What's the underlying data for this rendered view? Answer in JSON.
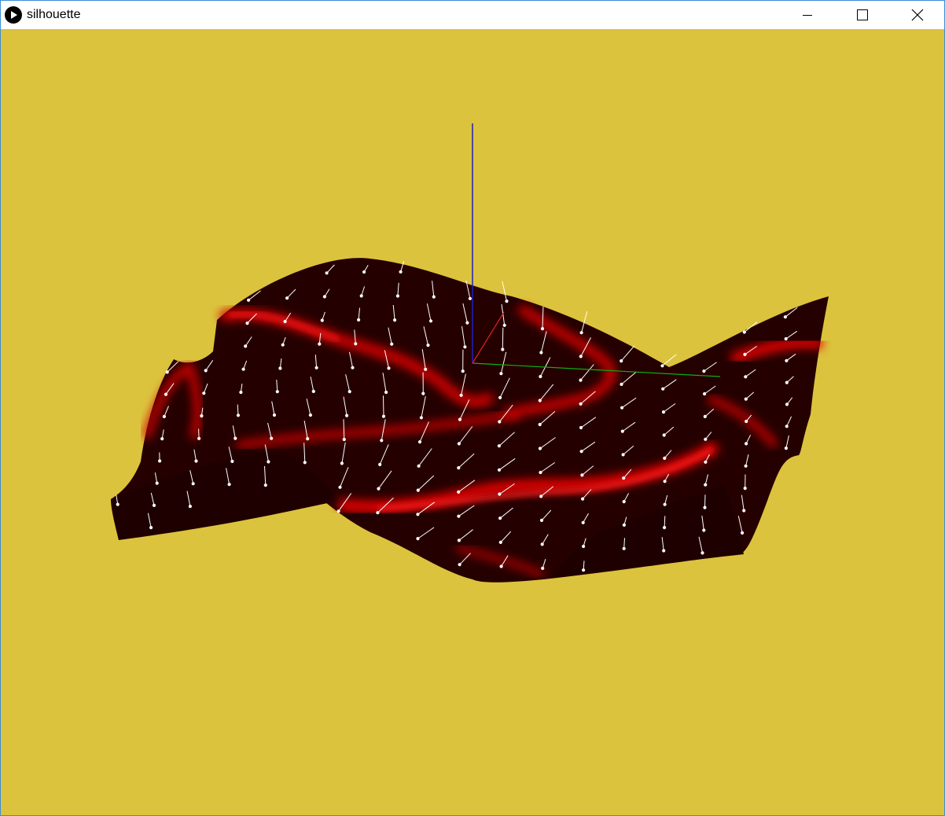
{
  "window": {
    "title": "silhouette",
    "app_icon": "play-circle-icon",
    "controls": [
      "minimize-icon",
      "maximize-icon",
      "close-icon"
    ]
  },
  "canvas": {
    "background": "#dcc33d",
    "surface_dark": "#280000",
    "surface_highlight": "#e00000",
    "normal_color": "#ffffff",
    "axes": {
      "x": "#e02020",
      "y": "#10b010",
      "z": "#2020c0"
    }
  }
}
